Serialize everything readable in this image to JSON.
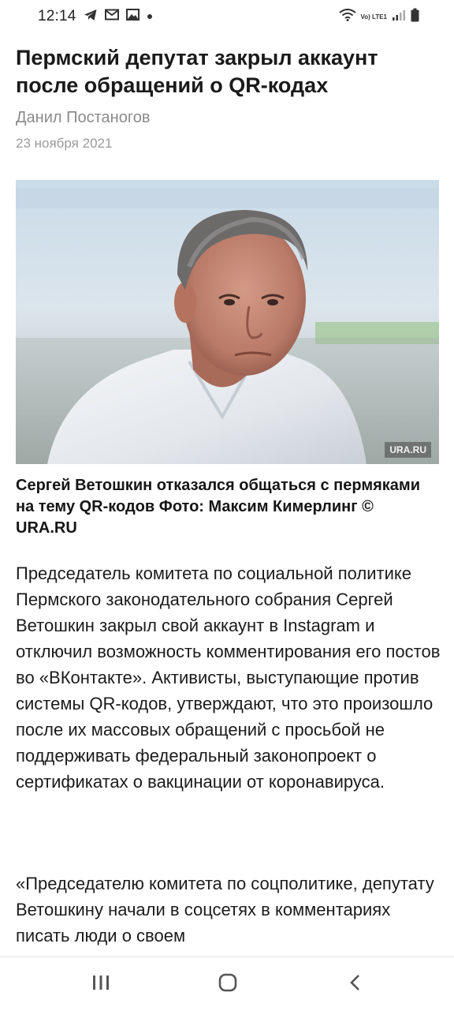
{
  "status_bar": {
    "time": "12:14",
    "network": "Vo) LTE1"
  },
  "article": {
    "title": "Пермский депутат закрыл аккаунт после обращений о QR-кодах",
    "author": "Данил Постаногов",
    "date": "23 ноября 2021",
    "photo_watermark": "URA.RU",
    "caption": "Сергей Ветошкин отказался общаться с пермяками на тему QR-кодов Фото: Максим Кимерлинг © URA.RU",
    "paragraphs": [
      "Председатель комитета по социальной политике Пермского законодательного собрания Сергей Ветошкин закрыл свой аккаунт в Instagram и отключил возможность комментирования его постов во «ВКонтакте». Активисты, выступающие против системы QR-кодов, утверждают, что это произошло после их массовых обращений с просьбой не поддерживать федеральный законопроект о сертификатах о вакцинации от коронавируса.",
      "«Председателю комитета по соцполитике, депутату Ветошкину начали в соцсетях в комментариях писать люди о своем"
    ]
  },
  "icons": {
    "status_left": [
      "telegram-icon",
      "mail-icon",
      "gallery-icon",
      "dot-icon"
    ],
    "status_right": [
      "wifi-icon",
      "signal-icon",
      "battery-icon"
    ],
    "nav": [
      "recents-icon",
      "home-icon",
      "back-icon"
    ]
  }
}
